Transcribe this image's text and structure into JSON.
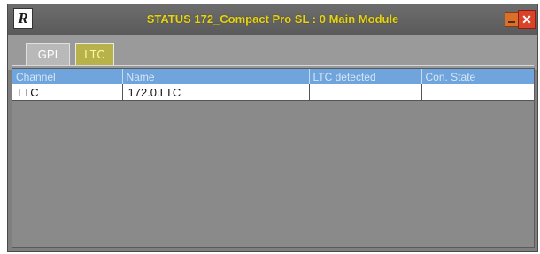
{
  "window": {
    "app_icon_letter": "R",
    "title": "STATUS 172_Compact Pro SL : 0 Main Module",
    "minimize_icon": "minimize-icon",
    "close_icon": "close-icon",
    "close_glyph": "✕",
    "accent_color": "#e6d21a",
    "header_color": "#6fa5dc"
  },
  "tabs": [
    {
      "label": "GPI",
      "selected": false
    },
    {
      "label": "LTC",
      "selected": true
    }
  ],
  "table": {
    "columns": [
      "Channel",
      "Name",
      "LTC detected",
      "Con. State"
    ],
    "rows": [
      {
        "channel": "LTC",
        "name": "172.0.LTC",
        "ltc_detected": "",
        "con_state": ""
      }
    ]
  }
}
